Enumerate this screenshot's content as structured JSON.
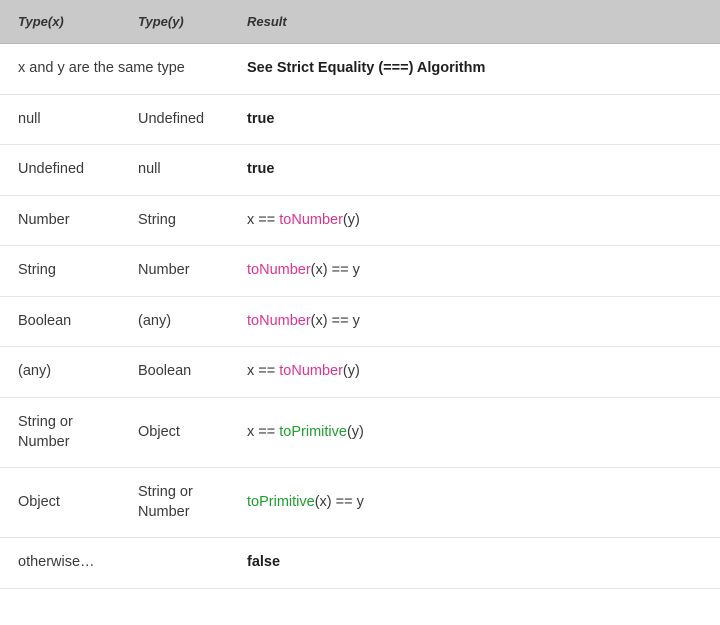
{
  "table": {
    "headers": {
      "type_x": "Type(x)",
      "type_y": "Type(y)",
      "result": "Result"
    },
    "colors": {
      "header_bg": "#c9c9c9",
      "fn_number": "#e0338e",
      "fn_primitive": "#1f9d2f",
      "text": "#3a3a3a",
      "row_border": "#e4e4e4"
    },
    "rows": [
      {
        "type_x": "x and y are the same type",
        "type_y": "",
        "result_bold": "See Strict Equality (===) Algorithm",
        "style": "bold",
        "merged": true
      },
      {
        "type_x": "null",
        "type_y": "Undefined",
        "result_bold": "true",
        "style": "bold",
        "merged": false
      },
      {
        "type_x": "Undefined",
        "type_y": "null",
        "result_bold": "true",
        "style": "bold",
        "merged": false
      },
      {
        "type_x": "Number",
        "type_y": "String",
        "style": "code",
        "merged": false,
        "result_parts": [
          {
            "text": "x == ",
            "color": "plain"
          },
          {
            "text": "toNumber",
            "color": "pink"
          },
          {
            "text": "(y)",
            "color": "plain"
          }
        ]
      },
      {
        "type_x": "String",
        "type_y": "Number",
        "style": "code",
        "merged": false,
        "result_parts": [
          {
            "text": "toNumber",
            "color": "pink"
          },
          {
            "text": "(x) == y",
            "color": "plain"
          }
        ]
      },
      {
        "type_x": "Boolean",
        "type_y": "(any)",
        "style": "code",
        "merged": false,
        "result_parts": [
          {
            "text": "toNumber",
            "color": "pink"
          },
          {
            "text": "(x) == y",
            "color": "plain"
          }
        ]
      },
      {
        "type_x": "(any)",
        "type_y": "Boolean",
        "style": "code",
        "merged": false,
        "result_parts": [
          {
            "text": "x == ",
            "color": "plain"
          },
          {
            "text": "toNumber",
            "color": "pink"
          },
          {
            "text": "(y)",
            "color": "plain"
          }
        ]
      },
      {
        "type_x": "String or Number",
        "type_y": "Object",
        "style": "code",
        "merged": false,
        "result_parts": [
          {
            "text": "x == ",
            "color": "plain"
          },
          {
            "text": "toPrimitive",
            "color": "green"
          },
          {
            "text": "(y)",
            "color": "plain"
          }
        ]
      },
      {
        "type_x": "Object",
        "type_y": "String or Number",
        "style": "code",
        "merged": false,
        "result_parts": [
          {
            "text": "toPrimitive",
            "color": "green"
          },
          {
            "text": "(x) == y",
            "color": "plain"
          }
        ]
      },
      {
        "type_x": "otherwise…",
        "type_y": "",
        "result_bold": "false",
        "style": "bold",
        "merged": true
      }
    ]
  }
}
